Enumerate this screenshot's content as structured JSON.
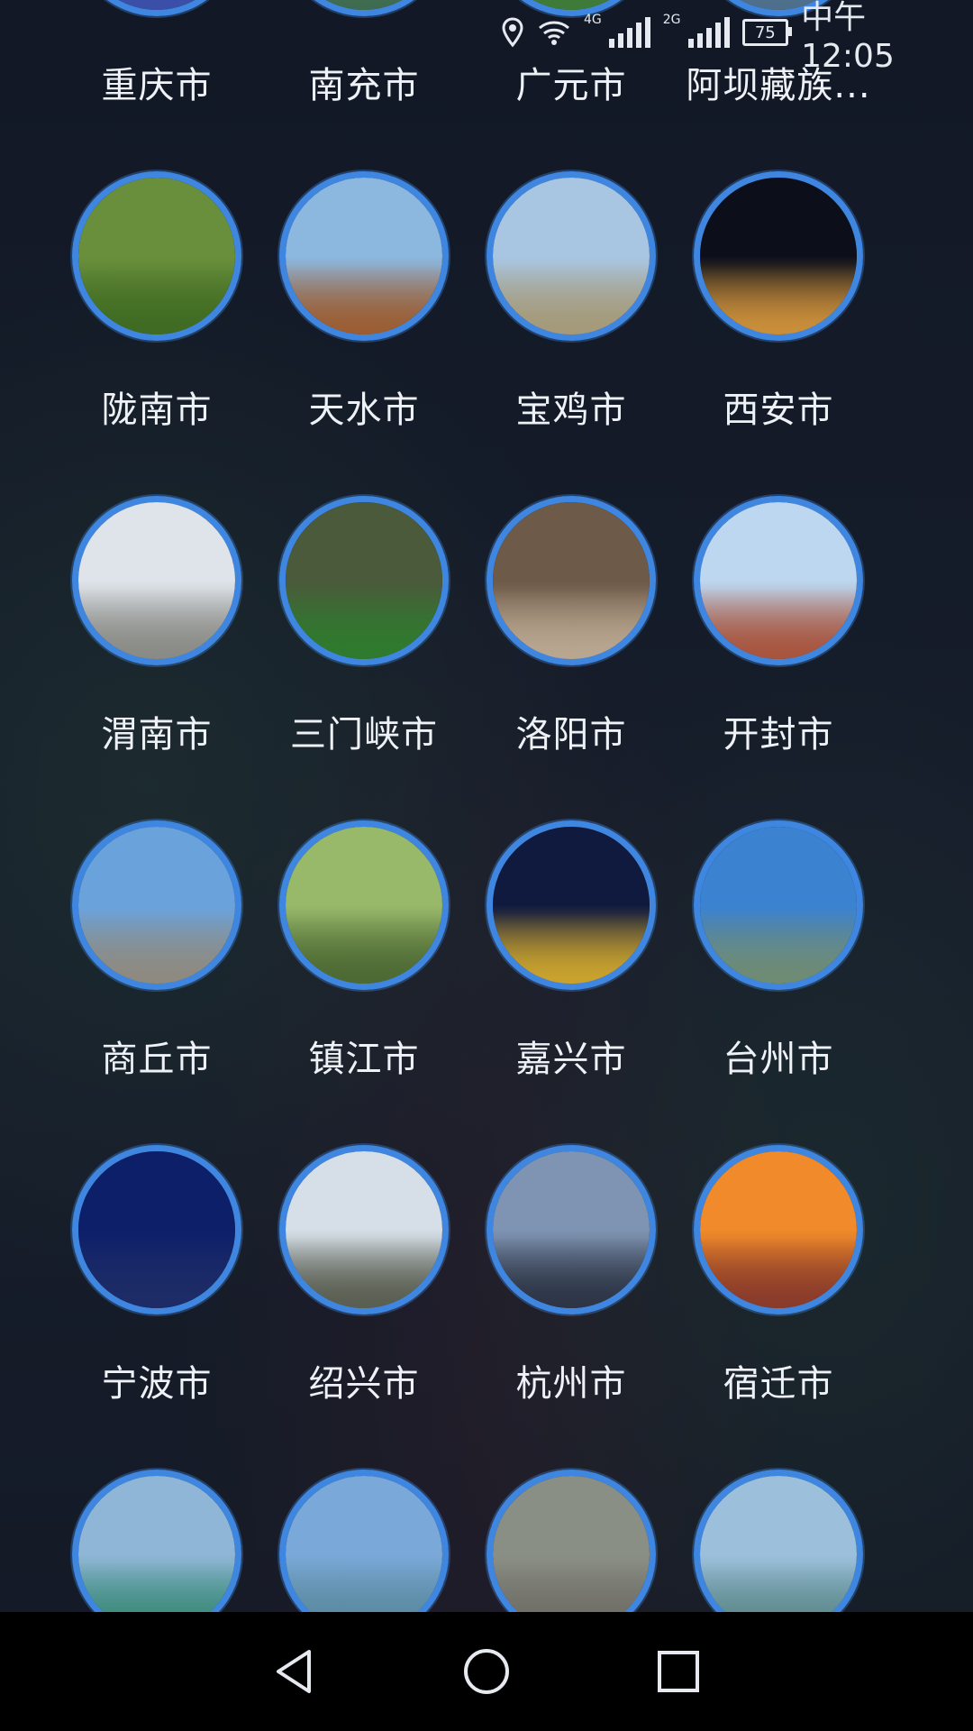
{
  "status_bar": {
    "time": "中午12:05",
    "battery": "75",
    "network_1": "4G",
    "network_2": "2G",
    "icons": [
      "location-icon",
      "wifi-icon",
      "signal-icon",
      "battery-icon"
    ]
  },
  "colors": {
    "background": "#141a26",
    "ring": "#3e86df",
    "label": "#eef1f6",
    "nav_bar": "#000000"
  },
  "cities": [
    {
      "label": "重庆市",
      "sky": "#2a3fc4",
      "ground": "#3b4fa8"
    },
    {
      "label": "南充市",
      "sky": "#5e8f74",
      "ground": "#3f6b50"
    },
    {
      "label": "广元市",
      "sky": "#6c9d5a",
      "ground": "#3e7a38"
    },
    {
      "label": "阿坝藏族...",
      "sky": "#7d9bb8",
      "ground": "#4e6f8c"
    },
    {
      "label": "陇南市",
      "sky": "#6a8f3c",
      "ground": "#3f6b22"
    },
    {
      "label": "天水市",
      "sky": "#8cb8e0",
      "ground": "#9b5e34"
    },
    {
      "label": "宝鸡市",
      "sky": "#a8c6e2",
      "ground": "#a59a7a"
    },
    {
      "label": "西安市",
      "sky": "#0c0f1a",
      "ground": "#c98e3a"
    },
    {
      "label": "渭南市",
      "sky": "#dfe4ea",
      "ground": "#8a8b86"
    },
    {
      "label": "三门峡市",
      "sky": "#4a5a3a",
      "ground": "#2f7a2e"
    },
    {
      "label": "洛阳市",
      "sky": "#6d5a48",
      "ground": "#b8a690"
    },
    {
      "label": "开封市",
      "sky": "#bcd7ef",
      "ground": "#a8553e"
    },
    {
      "label": "商丘市",
      "sky": "#6aa3dc",
      "ground": "#8e8a80"
    },
    {
      "label": "镇江市",
      "sky": "#98b86a",
      "ground": "#4e6a34"
    },
    {
      "label": "嘉兴市",
      "sky": "#101a3e",
      "ground": "#c9a22e"
    },
    {
      "label": "台州市",
      "sky": "#3b82d0",
      "ground": "#6f8b74"
    },
    {
      "label": "宁波市",
      "sky": "#0e1f6a",
      "ground": "#1d2c66"
    },
    {
      "label": "绍兴市",
      "sky": "#d6dfe8",
      "ground": "#5a5f52"
    },
    {
      "label": "杭州市",
      "sky": "#7f94b2",
      "ground": "#2d3546"
    },
    {
      "label": "宿迁市",
      "sky": "#f08a2a",
      "ground": "#8a3b2a"
    },
    {
      "label": "",
      "sky": "#8fb6d6",
      "ground": "#3b8a7a"
    },
    {
      "label": "",
      "sky": "#7aa8d8",
      "ground": "#5a8aa0"
    },
    {
      "label": "",
      "sky": "#8a8f86",
      "ground": "#6f6e66"
    },
    {
      "label": "",
      "sky": "#9cc0dc",
      "ground": "#5d8a8c"
    }
  ],
  "nav": {
    "back": "back-icon",
    "home": "home-icon",
    "recents": "recents-icon"
  }
}
